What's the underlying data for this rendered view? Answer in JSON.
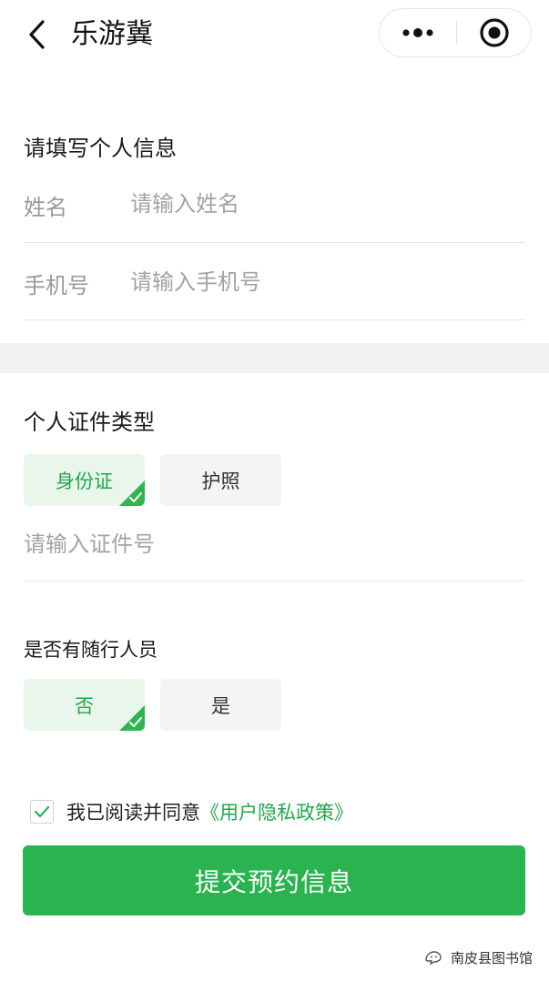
{
  "nav": {
    "title": "乐游冀",
    "back_icon": "chevron-left-icon",
    "more_icon": "more-dots-icon",
    "close_icon": "target-close-icon"
  },
  "personal": {
    "section_title": "请填写个人信息",
    "name_label": "姓名",
    "name_placeholder": "请输入姓名",
    "name_value": "",
    "phone_label": "手机号",
    "phone_placeholder": "请输入手机号",
    "phone_value": ""
  },
  "id_type": {
    "section_title": "个人证件类型",
    "options": [
      {
        "label": "身份证",
        "selected": true
      },
      {
        "label": "护照",
        "selected": false
      }
    ],
    "id_placeholder": "请输入证件号",
    "id_value": ""
  },
  "companion": {
    "section_title": "是否有随行人员",
    "options": [
      {
        "label": "否",
        "selected": true
      },
      {
        "label": "是",
        "selected": false
      }
    ]
  },
  "agreement": {
    "checked": true,
    "text": "我已阅读并同意",
    "link": "《用户隐私政策》"
  },
  "submit_label": "提交预约信息",
  "watermark": "南皮县图书馆",
  "colors": {
    "accent": "#2ab34f",
    "selected_bg": "#e8f6ec",
    "selected_text": "#22a84a",
    "band": "#f1f1f3"
  }
}
